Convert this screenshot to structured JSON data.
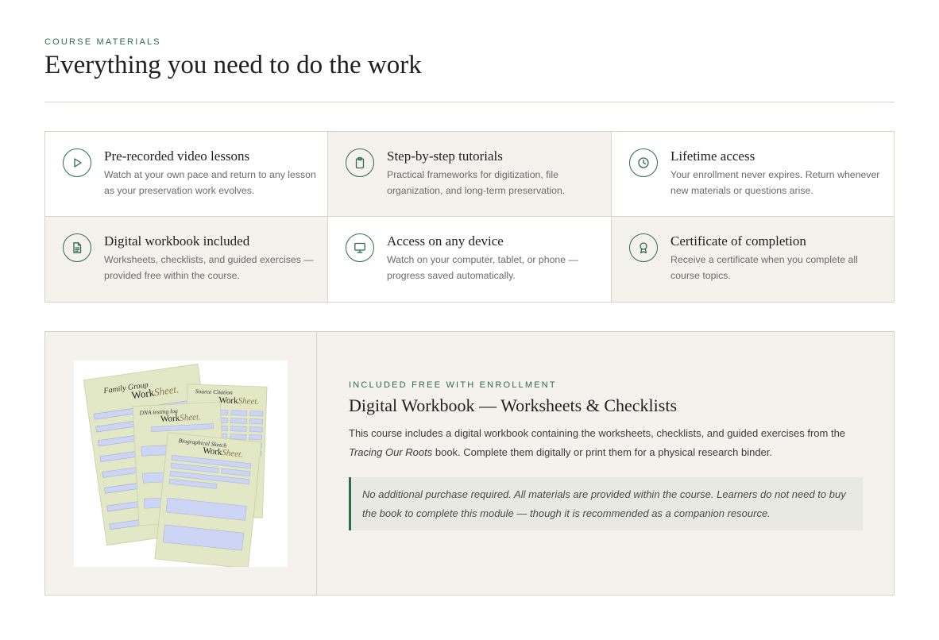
{
  "section": {
    "eyebrow": "COURSE MATERIALS",
    "title": "Everything you need to do the work"
  },
  "features": [
    {
      "title": "Pre-recorded video lessons",
      "desc": "Watch at your own pace and return to any lesson as your preservation work evolves.",
      "icon": "play-icon"
    },
    {
      "title": "Step-by-step tutorials",
      "desc": "Practical frameworks for digitization, file organization, and long-term preservation.",
      "icon": "clipboard-icon"
    },
    {
      "title": "Lifetime access",
      "desc": "Your enrollment never expires. Return whenever new materials or questions arise.",
      "icon": "clock-icon"
    },
    {
      "title": "Digital workbook included",
      "desc": "Worksheets, checklists, and guided exercises — provided free within the course.",
      "icon": "document-icon"
    },
    {
      "title": "Access on any device",
      "desc": "Watch on your computer, tablet, or phone — progress saved automatically.",
      "icon": "monitor-icon"
    },
    {
      "title": "Certificate of completion",
      "desc": "Receive a certificate when you complete all course topics.",
      "icon": "award-icon"
    }
  ],
  "workbook": {
    "eyebrow": "INCLUDED FREE WITH ENROLLMENT",
    "title": "Digital Workbook — Worksheets & Checklists",
    "body_before": "This course includes a digital workbook containing the worksheets, checklists, and guided exercises from the ",
    "body_book": "Tracing Our Roots",
    "body_after": " book. Complete them digitally or print them for a physical research binder.",
    "note": "No additional purchase required. All materials are provided within the course. Learners do not need to buy the book to complete this module — though it is recommended as a companion resource.",
    "image_sheets": [
      {
        "heading": "Family Group",
        "brand_a": "Work",
        "brand_b": "Sheet."
      },
      {
        "heading": "Source Citation",
        "brand_a": "Work",
        "brand_b": "Sheet."
      },
      {
        "heading": "DNA testing log",
        "brand_a": "Work",
        "brand_b": "Sheet."
      },
      {
        "heading": "Biographical Sketch",
        "brand_a": "Work",
        "brand_b": "Sheet."
      }
    ]
  },
  "colors": {
    "accent": "#2e6b4a",
    "tint": "#f5f2ed",
    "border": "#d9d3c7",
    "field": "#ccd5f5",
    "sheet": "#e2e8c6"
  }
}
